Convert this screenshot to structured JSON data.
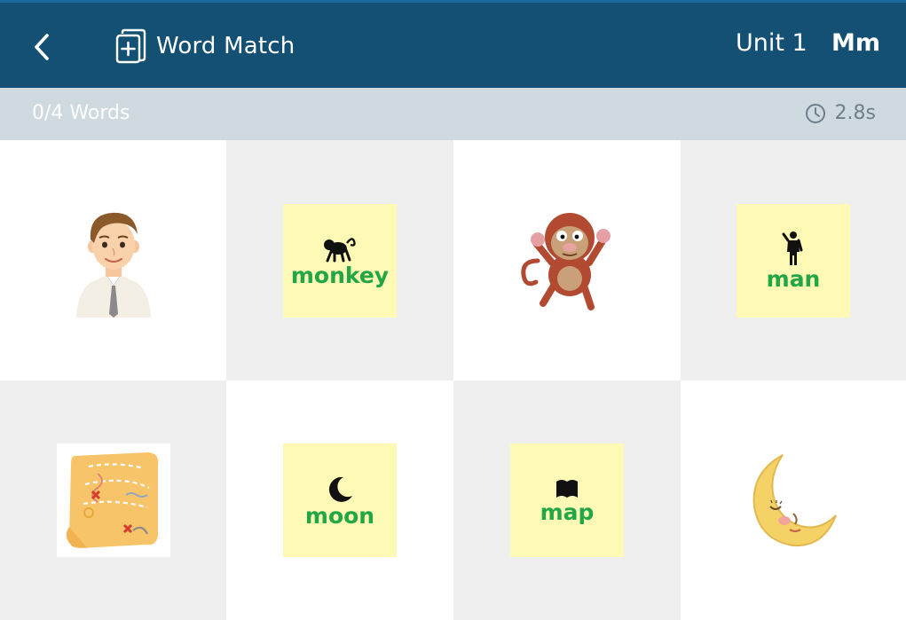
{
  "header": {
    "back_icon": "chevron-left-icon",
    "app_icon": "add-card-icon",
    "title": "Word Match",
    "unit": "Unit 1",
    "letter": "Mm",
    "background": "#135073"
  },
  "status": {
    "progress": "0/4 Words",
    "timer_icon": "clock-icon",
    "time": "2.8s"
  },
  "grid": {
    "cells": [
      {
        "kind": "picture",
        "picture": "man-illustration"
      },
      {
        "kind": "word",
        "icon": "monkey-silhouette-icon",
        "word": "monkey"
      },
      {
        "kind": "picture",
        "picture": "monkey-illustration"
      },
      {
        "kind": "word",
        "icon": "man-silhouette-icon",
        "word": "man"
      },
      {
        "kind": "picture",
        "picture": "map-illustration"
      },
      {
        "kind": "word",
        "icon": "crescent-moon-icon",
        "word": "moon"
      },
      {
        "kind": "word",
        "icon": "map-silhouette-icon",
        "word": "map"
      },
      {
        "kind": "picture",
        "picture": "moon-illustration"
      }
    ],
    "card_color": "#fff9b6",
    "word_color": "#22a646"
  }
}
